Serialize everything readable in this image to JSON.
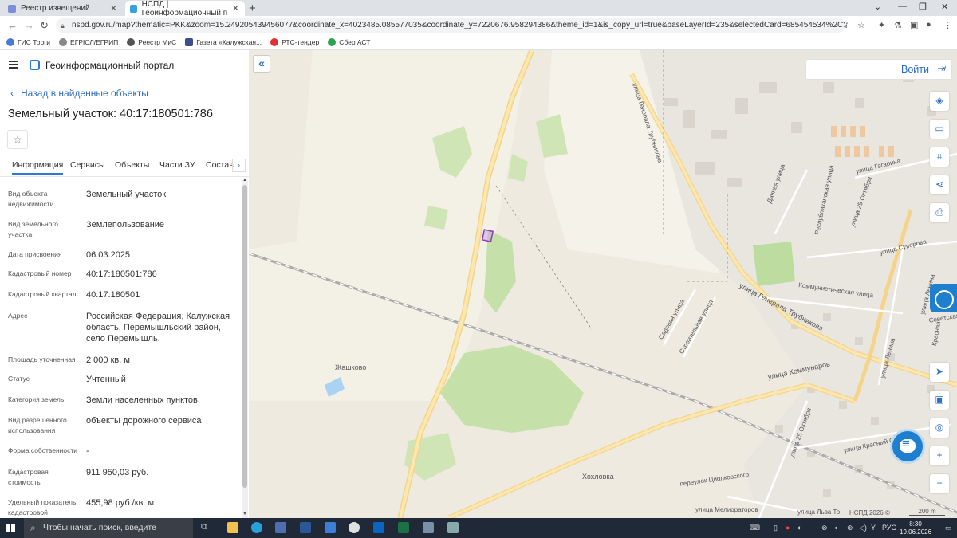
{
  "browser": {
    "tabs": [
      {
        "title": "Реестр извещений",
        "active": false
      },
      {
        "title": "НСПД | Геоинформационный п",
        "active": true
      }
    ],
    "url": "nspd.gov.ru/map?thematic=PKK&zoom=15.249205439456077&coordinate_x=4023485.085577035&coordinate_y=7220676.958294386&theme_id=1&is_copy_url=true&baseLayerId=235&selectedCard=685454534%2C36368%2C40%3A17%3A1805…",
    "bookmarks": [
      "ГИС Торги",
      "ЕГРЮЛ/ЕГРИП",
      "Реестр МиС",
      "Газета «Калужская...",
      "РТС-тендер",
      "Сбер АСТ"
    ]
  },
  "portal": {
    "title": "Геоинформационный портал",
    "back_label": "Назад в найденные объекты",
    "object_title": "Земельный участок: 40:17:180501:786",
    "tabs": [
      "Информация",
      "Сервисы",
      "Объекты",
      "Части ЗУ",
      "Состав"
    ],
    "info": [
      {
        "label": "Вид объекта недвижимости",
        "value": "Земельный участок"
      },
      {
        "label": "Вид земельного участка",
        "value": "Землепользование"
      },
      {
        "label": "Дата присвоения",
        "value": "06.03.2025"
      },
      {
        "label": "Кадастровый номер",
        "value": "40:17:180501:786"
      },
      {
        "label": "Кадастровый квартал",
        "value": "40:17:180501"
      },
      {
        "label": "Адрес",
        "value": "Российская Федерация, Калужская область, Перемышльский район, село Перемышль."
      },
      {
        "label": "Площадь уточненная",
        "value": "2 000 кв. м"
      },
      {
        "label": "Статус",
        "value": "Учтенный"
      },
      {
        "label": "Категория земель",
        "value": "Земли населенных пунктов"
      },
      {
        "label": "Вид разрешенного использования",
        "value": "объекты дорожного сервиса"
      },
      {
        "label": "Форма собственности",
        "value": "-"
      },
      {
        "label": "Кадастровая стоимость",
        "value": "911 950,03 руб."
      },
      {
        "label": "Удельный показатель кадастровой",
        "value": "455,98 руб./кв. м"
      }
    ]
  },
  "map": {
    "login_label": "Войти",
    "copyright": "НСПД 2026 ©",
    "scale_label": "200 m",
    "labels": {
      "trubnikova_1": "улица Генерала Трубникова",
      "trubnikova_2": "улица Генерала Трубникова",
      "kommunarov": "улица Коммунаров",
      "gagarina": "улица Гагарина",
      "suvorova": "улица Суворова",
      "kommunisticheskaya": "Коммунистическая улица",
      "oktyabrya_25": "улица 25 Октября",
      "oktyabrya_25b": "улица 25 Октября",
      "lenina": "улица Ленина",
      "lenina_b": "улица Ленина",
      "sadovaya": "Садовая улица",
      "stroitelnaya": "Строительная улица",
      "dachnaya": "Дачная улица",
      "respublikanskaya": "Республиканская улица",
      "sovetskaya": "Советская",
      "krasny_oktyabr": "улица Красный Октябрь",
      "tsiolkovskogo": "переулок Циолковского",
      "melioratorov": "улица Мелиораторов",
      "lva_tolstogo": "улица Льва То",
      "krasnaya": "Красная",
      "zhashkovo": "Жашково",
      "khokhlovka": "Хохловка"
    }
  },
  "taskbar": {
    "search_placeholder": "Чтобы начать поиск, введите",
    "lang": "РУС",
    "time": "8:30",
    "date": "19.06.2026"
  }
}
